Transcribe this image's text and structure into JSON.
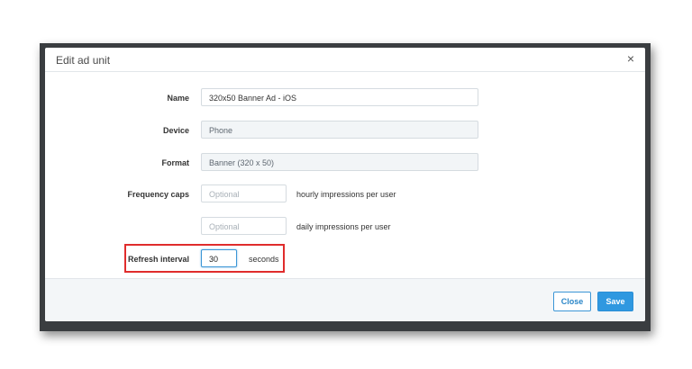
{
  "modal": {
    "title": "Edit ad unit",
    "close_symbol": "×"
  },
  "form": {
    "name": {
      "label": "Name",
      "value": "320x50 Banner Ad - iOS"
    },
    "device": {
      "label": "Device",
      "value": "Phone"
    },
    "format": {
      "label": "Format",
      "value": "Banner (320 x 50)"
    },
    "frequency_caps": {
      "label": "Frequency caps",
      "hourly": {
        "placeholder": "Optional",
        "suffix": "hourly impressions per user"
      },
      "daily": {
        "placeholder": "Optional",
        "suffix": "daily impressions per user"
      }
    },
    "refresh_interval": {
      "label": "Refresh interval",
      "value": "30",
      "suffix": "seconds"
    }
  },
  "footer": {
    "close_label": "Close",
    "save_label": "Save"
  },
  "colors": {
    "accent": "#2f98e0",
    "highlight": "#e02c2c"
  },
  "icons": {
    "close": "close-icon"
  }
}
